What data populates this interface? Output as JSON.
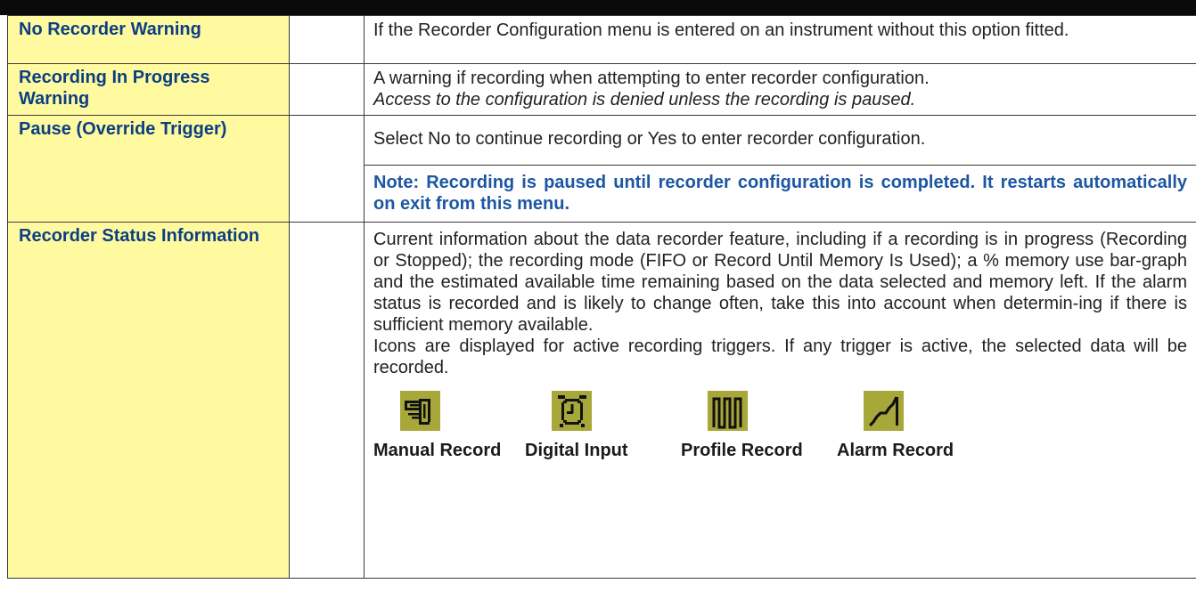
{
  "rows": [
    {
      "name": "No Recorder Warning",
      "desc": "If the Recorder Configuration menu is entered on an instrument without this option fitted."
    },
    {
      "name": "Recording In Progress Warning",
      "desc": "A warning if recording when attempting to enter recorder configuration.",
      "desc_italic": "Access to the configuration is denied unless the recording is paused."
    },
    {
      "name": "Pause (Override Trigger)",
      "desc": "Select No to continue recording or Yes to enter recorder configuration.",
      "note": "Note: Recording is paused until recorder configuration is completed. It restarts automatically on exit from this menu."
    },
    {
      "name": "Recorder Status Information",
      "desc": "Current information about the data recorder feature, including if a recording is in progress (Recording or Stopped); the recording mode (FIFO or Record Until Memory Is Used); a % memory use bar-graph and the estimated available time remaining based on the data selected and memory left. If the alarm status is recorded and is likely to change often, take this into account when determin-ing if there is sufficient memory available.",
      "desc2": "Icons are displayed for active recording triggers. If any trigger is active, the selected data will be recorded.",
      "icons": [
        {
          "label": "Manual Record",
          "icon": "hand-pointing-icon"
        },
        {
          "label": "Digital Input",
          "icon": "alarm-clock-icon"
        },
        {
          "label": "Profile Record",
          "icon": "square-wave-icon"
        },
        {
          "label": "Alarm Record",
          "icon": "ramp-alarm-icon"
        }
      ]
    }
  ],
  "colors": {
    "name_bg": "#fffaa0",
    "name_text": "#0b3f82",
    "note_text": "#1d57a3",
    "icon_bg": "#a8a83a"
  }
}
